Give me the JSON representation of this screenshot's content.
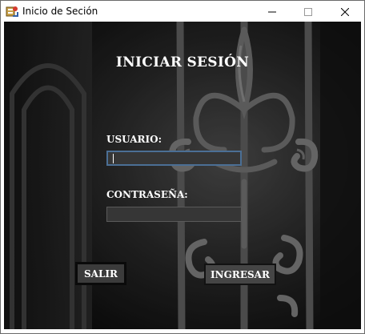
{
  "window": {
    "title": "Inicio de Seción",
    "icon": "java-app-icon",
    "controls": [
      "minimize-icon",
      "maximize-icon",
      "close-icon"
    ]
  },
  "form": {
    "heading": "INICIAR SESIÓN",
    "user_label": "USUARIO:",
    "user_value": "",
    "password_label": "CONTRASEÑA:",
    "password_value": ""
  },
  "buttons": {
    "exit_label": "SALIR",
    "login_label": "INGRESAR"
  },
  "colors": {
    "background": "#1d1d1d",
    "text": "#ffffff",
    "field_bg": "#363636",
    "focus_border": "#4b6f95",
    "button_bg": "#3b3b3b"
  }
}
